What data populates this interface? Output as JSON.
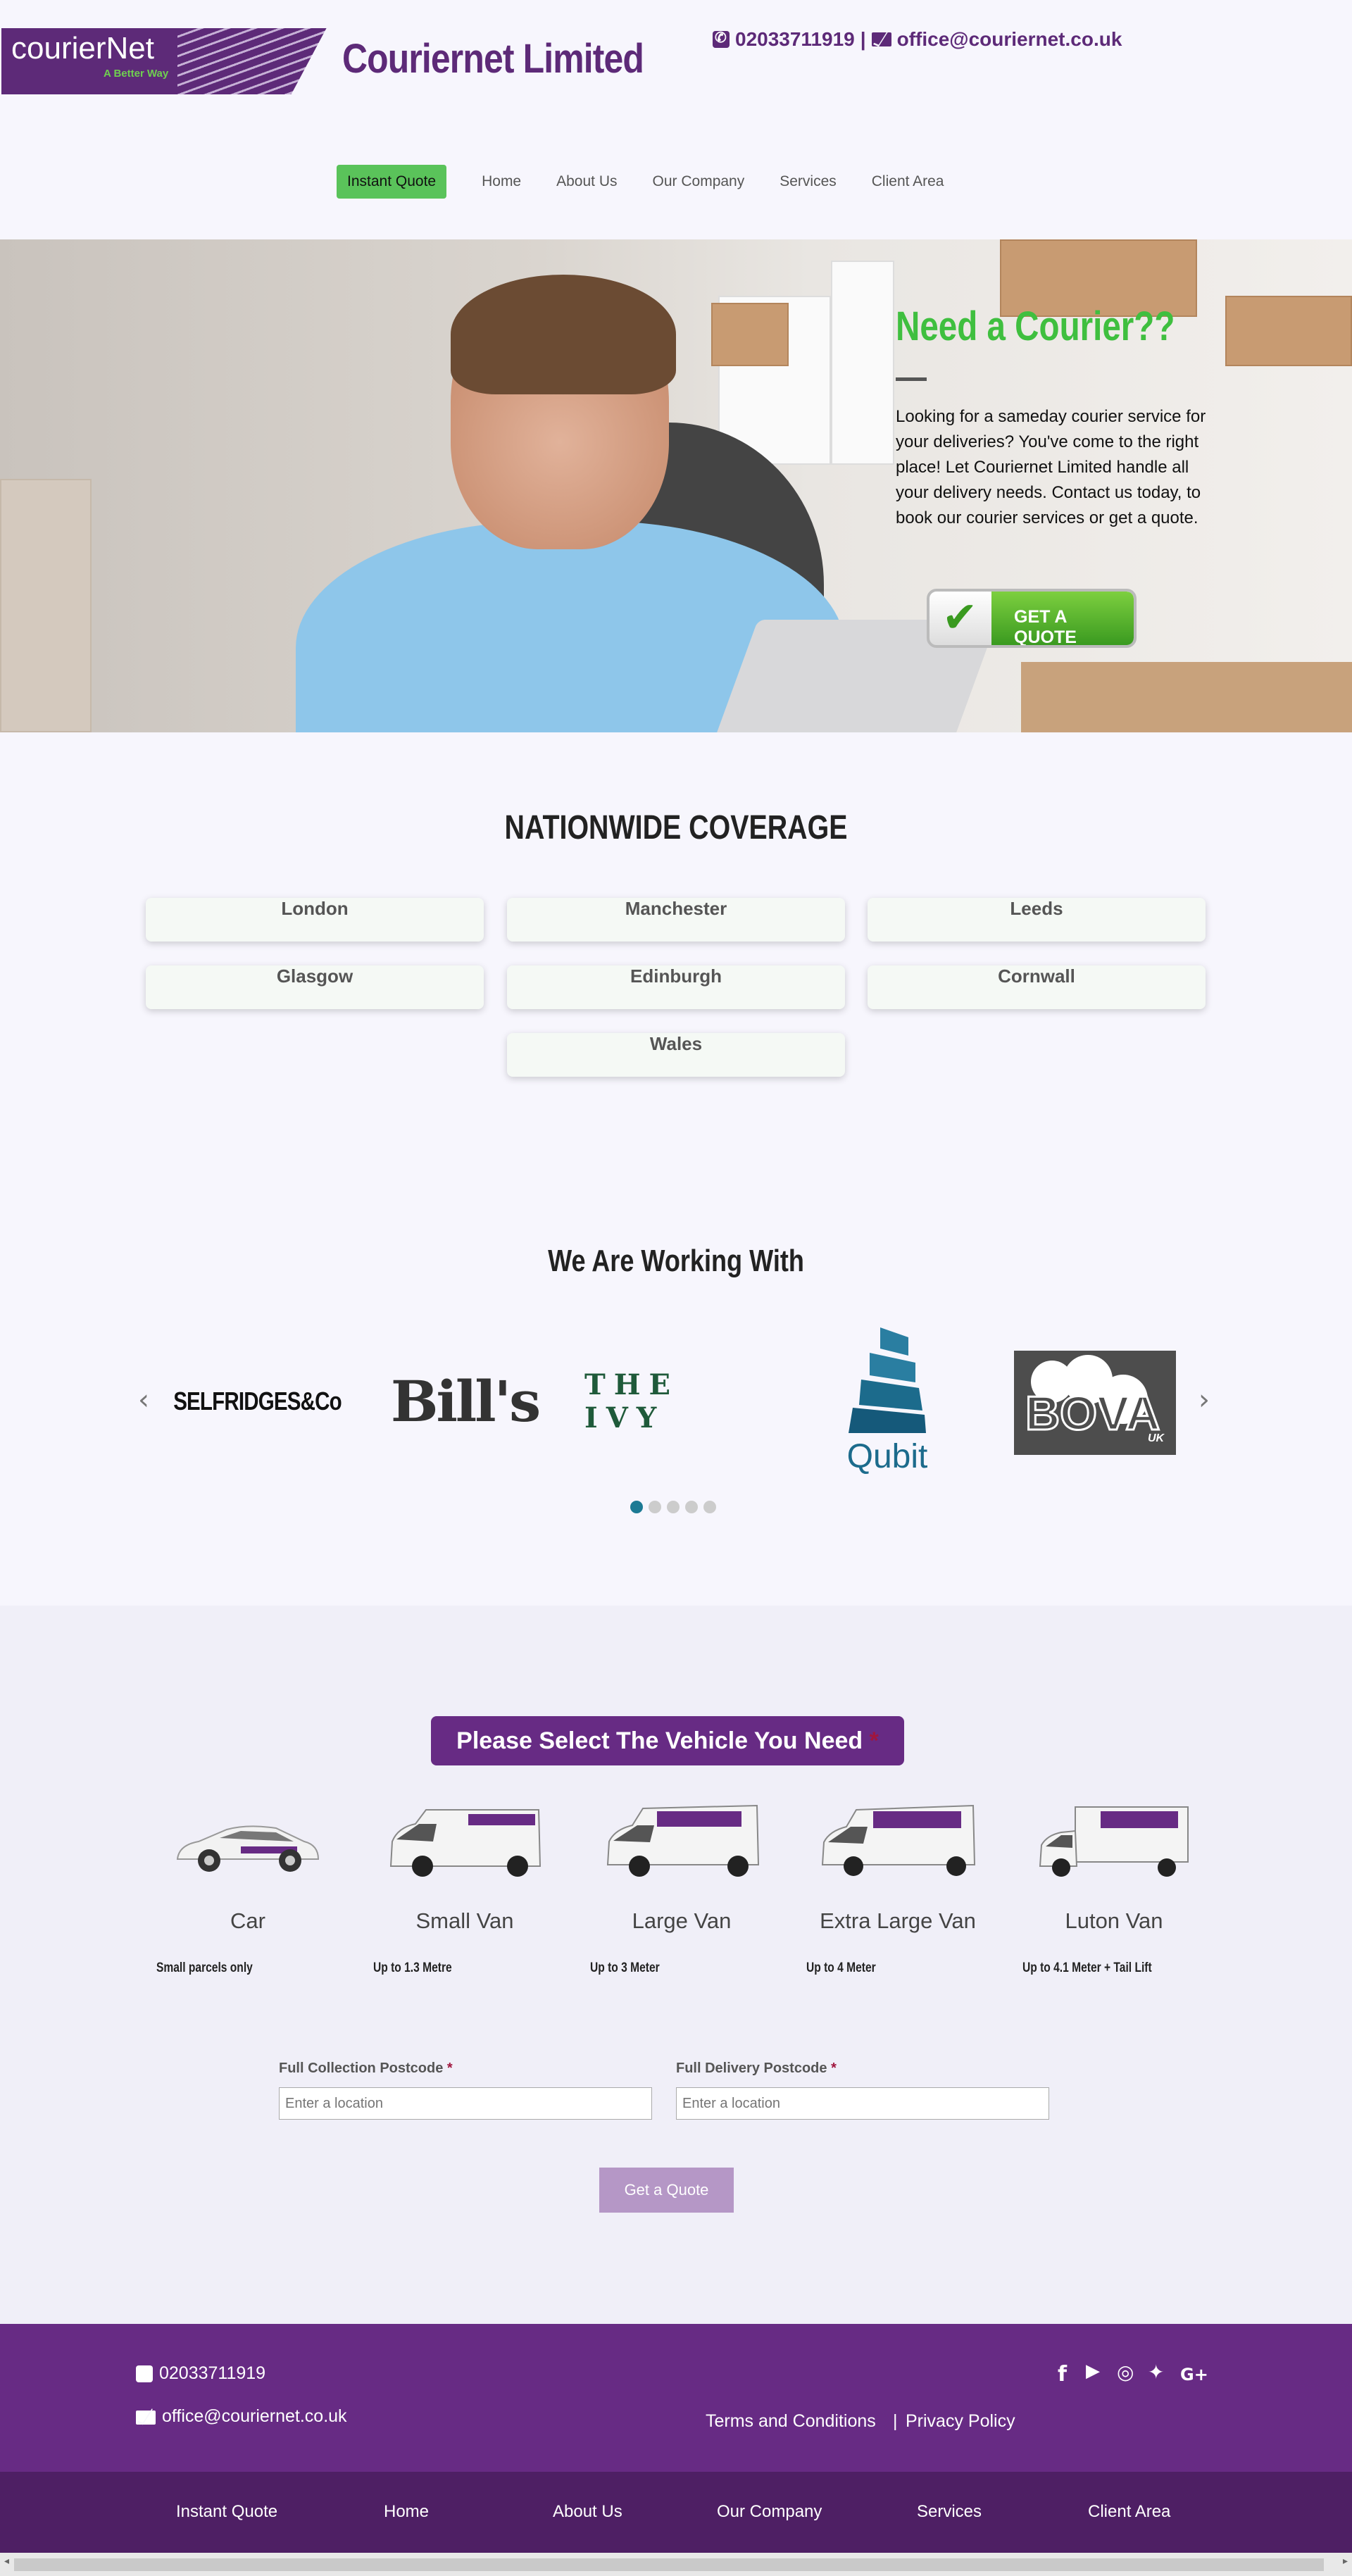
{
  "header": {
    "logo_name": "courierNet",
    "logo_tagline": "A Better Way",
    "brand_title": "Couriernet Limited",
    "phone": "02033711919",
    "separator": "|",
    "email": "office@couriernet.co.uk"
  },
  "nav": {
    "items": [
      {
        "label": "Instant Quote"
      },
      {
        "label": "Home"
      },
      {
        "label": "About Us"
      },
      {
        "label": "Our Company"
      },
      {
        "label": "Services"
      },
      {
        "label": "Client Area"
      }
    ]
  },
  "hero": {
    "title": "Need a Courier??",
    "text": "Looking for a sameday courier service for your deliveries? You've come to the right place! Let Couriernet Limited handle all your delivery needs. Contact us today, to book our courier services or get a quote.",
    "button_label": "GET A QUOTE"
  },
  "coverage": {
    "title": "NATIONWIDE COVERAGE",
    "cities": [
      "London",
      "Manchester",
      "Leeds",
      "Glasgow",
      "Edinburgh",
      "Cornwall",
      "Wales"
    ]
  },
  "partners": {
    "title": "We Are Working With",
    "logos": [
      {
        "name": "SELFRIDGES&Co"
      },
      {
        "name": "Bill's"
      },
      {
        "name": "THE IVY"
      },
      {
        "name": "Qubit"
      },
      {
        "name": "BOVA",
        "sub": "UK"
      }
    ],
    "active_dot": 0,
    "dot_count": 5
  },
  "vehicle_form": {
    "title": "Please Select The Vehicle You Need",
    "required_mark": "*",
    "vehicles": [
      {
        "name": "Car",
        "desc": "Small parcels only"
      },
      {
        "name": "Small Van",
        "desc": "Up to 1.3 Metre"
      },
      {
        "name": "Large Van",
        "desc": "Up to 3 Meter"
      },
      {
        "name": "Extra Large Van",
        "desc": "Up to 4 Meter"
      },
      {
        "name": "Luton Van",
        "desc": "Up to 4.1 Meter + Tail Lift"
      }
    ],
    "collection_label": "Full Collection Postcode",
    "delivery_label": "Full Delivery Postcode",
    "placeholder": "Enter a location",
    "submit_label": "Get a Quote"
  },
  "footer": {
    "phone": "02033711919",
    "email": "office@couriernet.co.uk",
    "terms": "Terms and Conditions",
    "separator": "|",
    "privacy": "Privacy Policy",
    "social_icons": [
      "facebook-icon",
      "youtube-icon",
      "instagram-icon",
      "twitter-icon",
      "google-plus-icon"
    ],
    "nav": [
      "Instant Quote",
      "Home",
      "About Us",
      "Our Company",
      "Services",
      "Client Area"
    ]
  },
  "colors": {
    "brand_purple": "#672b84",
    "accent_green": "#5ac35a",
    "footer_dark": "#4e1f64"
  }
}
